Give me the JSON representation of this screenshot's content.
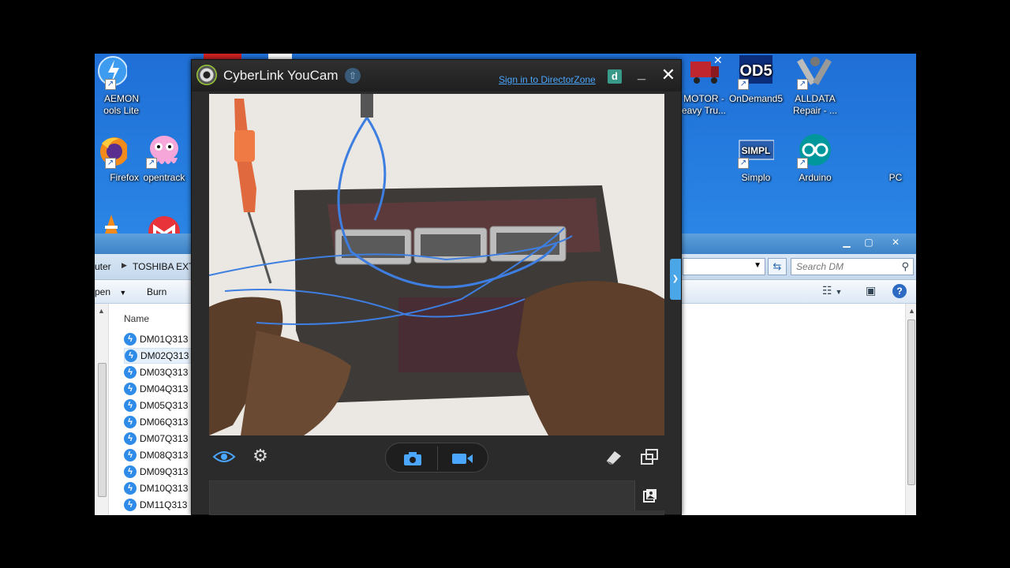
{
  "desktop": {
    "icons": [
      {
        "label": "AEMON\nools Lite",
        "icon": "daemon-tools-icon"
      },
      {
        "label": "Firefox",
        "icon": "firefox-icon"
      },
      {
        "label": "opentrack",
        "icon": "opentrack-icon"
      },
      {
        "label": "MOTOR -\neavy Tru...",
        "icon": "motor-truck-icon"
      },
      {
        "label": "OnDemand5",
        "icon": "ondemand5-icon",
        "badge": "OD5"
      },
      {
        "label": "ALLDATA\nRepair - ...",
        "icon": "alldata-icon"
      },
      {
        "label": "Simplo",
        "icon": "simplo-icon",
        "badge": "SIMPL"
      },
      {
        "label": "Arduino",
        "icon": "arduino-icon"
      },
      {
        "label": "PC",
        "icon": "pc-icon"
      }
    ]
  },
  "explorer": {
    "breadcrumb": [
      "uter",
      "TOSHIBA EXT"
    ],
    "search_placeholder": "Search DM",
    "toolbar": {
      "open_label": "pen",
      "burn_label": "Burn"
    },
    "column_name": "Name",
    "files": [
      "DM01Q313",
      "DM02Q313",
      "DM03Q313",
      "DM04Q313",
      "DM05Q313",
      "DM06Q313",
      "DM07Q313",
      "DM08Q313",
      "DM09Q313",
      "DM10Q313",
      "DM11Q313"
    ],
    "selected_index": 1
  },
  "youcam": {
    "title": "CyberLink YouCam",
    "director_zone_link": "Sign in to DirectorZone",
    "director_zone_badge": "d",
    "accent": "#4aa6ff"
  }
}
